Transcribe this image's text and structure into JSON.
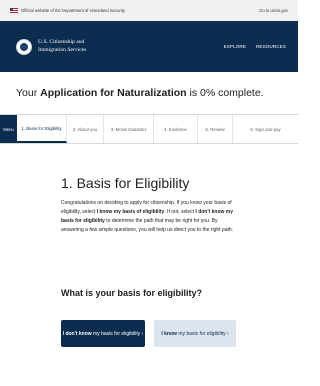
{
  "gov_banner": {
    "official_text": "Official website of the Department of Homeland Security",
    "language_link": "Go to uscis.gov"
  },
  "header": {
    "agency_line1": "U.S. Citizenship and",
    "agency_line2": "Immigration Services",
    "nav": [
      "EXPLORE",
      "RESOURCES"
    ]
  },
  "progress": {
    "prefix": "Your ",
    "form_name": "Application for Naturalization",
    "suffix": " is 0% complete.",
    "percent": 0
  },
  "steps": {
    "menu_label": "Menu",
    "items": [
      "1. Basis for Eligibility",
      "2. About you",
      "3. Moral character",
      "4. Evidence",
      "5. Review",
      "6. Sign and pay"
    ],
    "active_index": 0
  },
  "content": {
    "section_title": "1. Basis for Eligibility",
    "intro_1": "Congratulations on deciding to apply for citizenship. If you know your basis of eligibility, select ",
    "intro_bold_1": "I know my basis of eligibility",
    "intro_2": ". If not, select ",
    "intro_bold_2": "I don't know my basis for eligibility",
    "intro_3": " to determine the path that may be right for you. By answering a few simple questions, you will help us direct you to the right path.",
    "question": "What is your basis for eligibility?"
  },
  "buttons": {
    "dont_know_bold": "I don't know",
    "dont_know_rest": " my basis for eligibility ›",
    "know_bold": "I know",
    "know_rest": " my basis for eligibility ›"
  },
  "colors": {
    "navy": "#0b2d50",
    "light_button": "#dce4ef",
    "banner_gray": "#f1f1f1"
  },
  "icons": [
    "us-flag-icon",
    "dhs-seal-icon"
  ]
}
